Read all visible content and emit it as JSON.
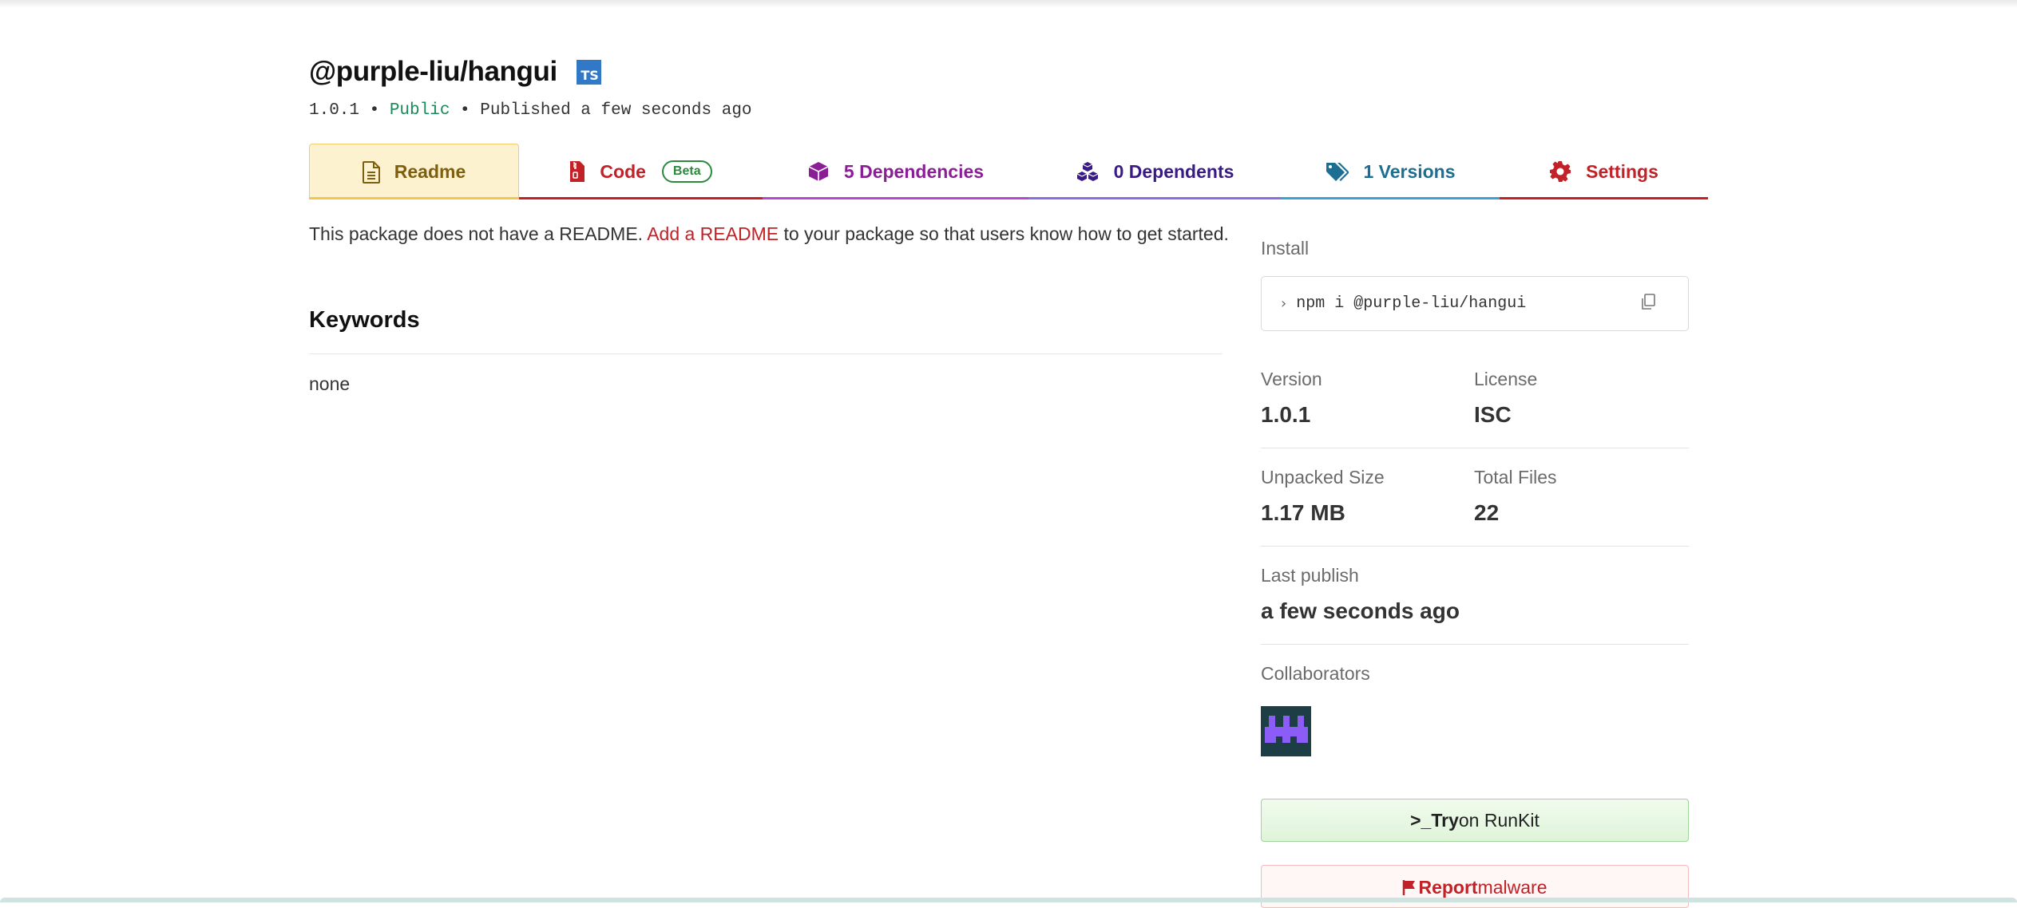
{
  "package": {
    "name": "@purple-liu/hangui",
    "ts_badge": "TS",
    "version": "1.0.1",
    "separator1": " • ",
    "visibility": "Public",
    "separator2": " • ",
    "published": "Published a few seconds ago"
  },
  "tabs": [
    {
      "label": "Readme",
      "icon": "document-icon"
    },
    {
      "label": "Code",
      "badge": "Beta",
      "icon": "file-zip-icon"
    },
    {
      "label": "5 Dependencies",
      "icon": "box-icon"
    },
    {
      "label": "0 Dependents",
      "icon": "boxes-icon"
    },
    {
      "label": "1 Versions",
      "icon": "tags-icon"
    },
    {
      "label": "Settings",
      "icon": "gear-icon"
    }
  ],
  "readme": {
    "note_prefix": "This package does not have a README. ",
    "note_link": "Add a README",
    "note_suffix": " to your package so that users know how to get started."
  },
  "keywords": {
    "title": "Keywords",
    "value": "none"
  },
  "sidebar": {
    "install_label": "Install",
    "install_prompt": "›",
    "install_command": "npm i @purple-liu/hangui",
    "version_label": "Version",
    "version_value": "1.0.1",
    "license_label": "License",
    "license_value": "ISC",
    "unpacked_label": "Unpacked Size",
    "unpacked_value": "1.17 MB",
    "files_label": "Total Files",
    "files_value": "22",
    "last_publish_label": "Last publish",
    "last_publish_value": "a few seconds ago",
    "collaborators_label": "Collaborators",
    "runkit_prefix": ">_",
    "runkit_strong": "Try",
    "runkit_rest": " on RunKit",
    "report_strong": "Report",
    "report_rest": " malware"
  },
  "colors": {
    "accent_red": "#c12127",
    "public_green": "#1b8a5a",
    "ts_blue": "#3178c6",
    "avatar_bg": "#1d3e45",
    "avatar_fg": "#8b5cf6"
  }
}
